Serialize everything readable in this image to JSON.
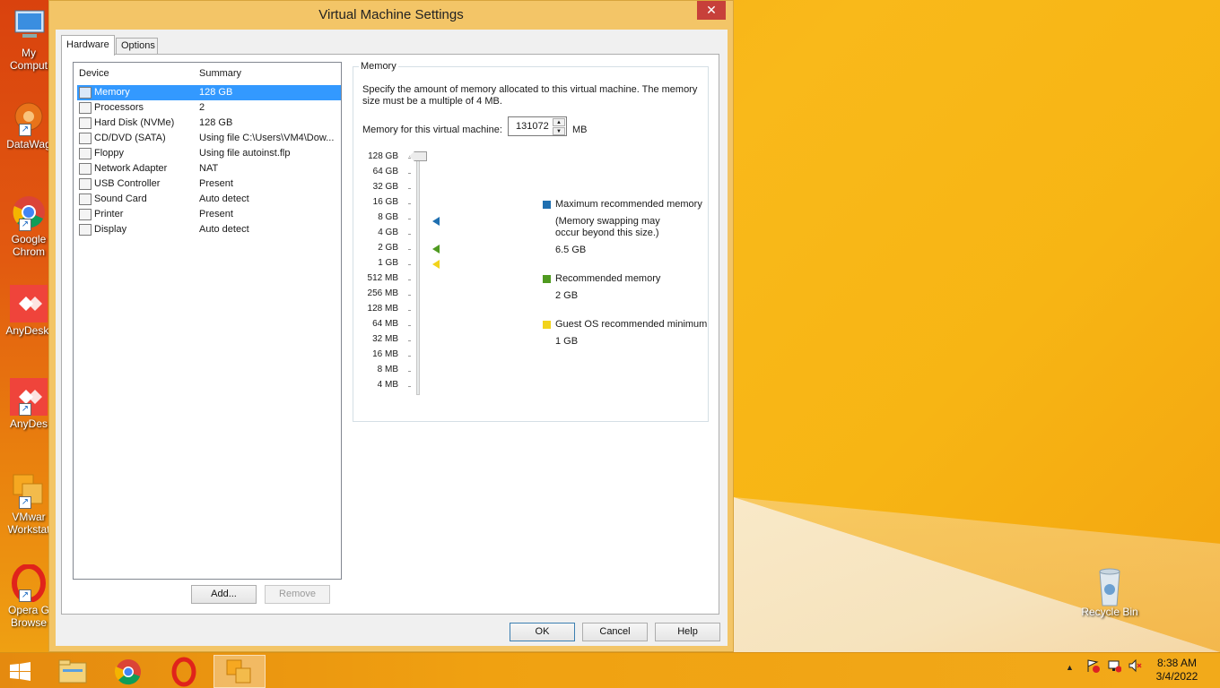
{
  "window": {
    "title": "Virtual Machine Settings",
    "close_label": "✕",
    "tabs": [
      "Hardware",
      "Options"
    ]
  },
  "devices": {
    "header_device": "Device",
    "header_summary": "Summary",
    "rows": [
      {
        "name": "Memory",
        "summary": "128 GB",
        "icon": "memory-icon"
      },
      {
        "name": "Processors",
        "summary": "2",
        "icon": "processor-icon"
      },
      {
        "name": "Hard Disk (NVMe)",
        "summary": "128 GB",
        "icon": "hard-disk-icon"
      },
      {
        "name": "CD/DVD (SATA)",
        "summary": "Using file C:\\Users\\VM4\\Dow...",
        "icon": "cd-dvd-icon"
      },
      {
        "name": "Floppy",
        "summary": "Using file autoinst.flp",
        "icon": "floppy-icon"
      },
      {
        "name": "Network Adapter",
        "summary": "NAT",
        "icon": "network-adapter-icon"
      },
      {
        "name": "USB Controller",
        "summary": "Present",
        "icon": "usb-icon"
      },
      {
        "name": "Sound Card",
        "summary": "Auto detect",
        "icon": "speaker-icon"
      },
      {
        "name": "Printer",
        "summary": "Present",
        "icon": "printer-icon"
      },
      {
        "name": "Display",
        "summary": "Auto detect",
        "icon": "display-icon"
      }
    ],
    "add_label": "Add...",
    "remove_label": "Remove"
  },
  "memory": {
    "group_label": "Memory",
    "description": "Specify the amount of memory allocated to this virtual machine. The memory size must be a multiple of 4 MB.",
    "field_label": "Memory for this virtual machine:",
    "value": "131072",
    "unit": "MB",
    "scale": [
      "128 GB",
      "64 GB",
      "32 GB",
      "16 GB",
      "8 GB",
      "4 GB",
      "2 GB",
      "1 GB",
      "512 MB",
      "256 MB",
      "128 MB",
      "64 MB",
      "32 MB",
      "16 MB",
      "8 MB",
      "4 MB"
    ],
    "legend": {
      "max_title": "Maximum recommended memory",
      "max_note": "(Memory swapping may occur beyond this size.)",
      "max_value": "6.5 GB",
      "rec_title": "Recommended memory",
      "rec_value": "2 GB",
      "min_title": "Guest OS recommended minimum",
      "min_value": "1 GB"
    },
    "colors": {
      "max": "#1f6fb0",
      "rec": "#4f9a20",
      "min": "#f2d31b"
    }
  },
  "footer": {
    "ok": "OK",
    "cancel": "Cancel",
    "help": "Help"
  },
  "desktop": {
    "icons": [
      {
        "label": "My\nComput",
        "icon": "computer-icon"
      },
      {
        "label": "DataWag",
        "icon": "datawagon-icon"
      },
      {
        "label": "Google\nChrom",
        "icon": "chrome-icon"
      },
      {
        "label": "AnyDesk.",
        "icon": "anydesk-icon"
      },
      {
        "label": "AnyDes",
        "icon": "anydesk-icon"
      },
      {
        "label": "VMwar\nWorkstat",
        "icon": "vmware-icon"
      },
      {
        "label": "Opera G\nBrowse",
        "icon": "opera-icon"
      }
    ],
    "recycle_bin": "Recycle Bin"
  },
  "taskbar": {
    "time": "8:38 AM",
    "date": "3/4/2022"
  }
}
